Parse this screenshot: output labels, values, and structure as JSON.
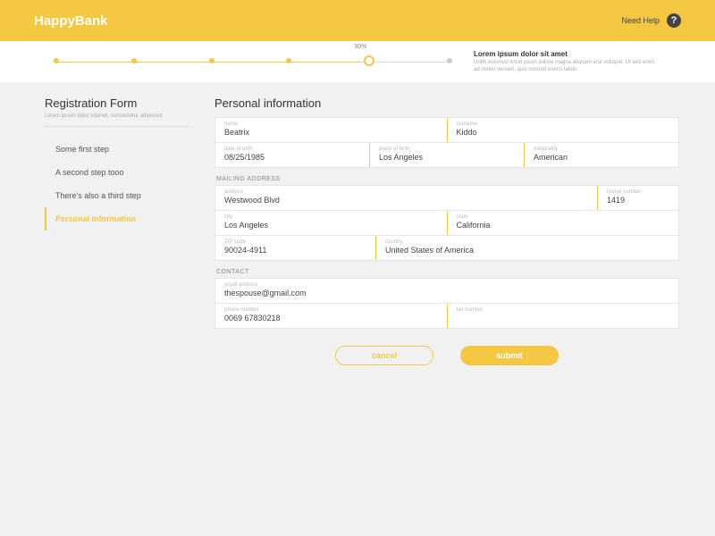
{
  "header": {
    "brand": "HappyBank",
    "help_label": "Need Help"
  },
  "progress": {
    "percent_label": "90%",
    "title": "Lorem ipsum dolor sit amet",
    "description": "Unbh euismod tincid psum dolore magna aliquam erat volutpat. Ut wisi enim ad minim veniam, quis nostrud exerci tation."
  },
  "sidebar": {
    "title": "Registration Form",
    "subtitle": "Lorem ipsum dolor sitamet, consectetur adipiscint",
    "steps": [
      "Some first step",
      "A second step tooo",
      "There's also a third step",
      "Personal information"
    ]
  },
  "content": {
    "title": "Personal information",
    "personal": {
      "name_label": "name",
      "name_value": "Beatrix",
      "surname_label": "surname",
      "surname_value": "Kiddo",
      "dob_label": "date of birth",
      "dob_value": "08/25/1985",
      "pob_label": "place of birth",
      "pob_value": "Los Angeles",
      "nat_label": "nationality",
      "nat_value": "American"
    },
    "mailing_section": "MAILING ADDRESS",
    "mailing": {
      "address_label": "address",
      "address_value": "Westwood Blvd",
      "house_label": "house number",
      "house_value": "1419",
      "city_label": "city",
      "city_value": "Los Angeles",
      "state_label": "state",
      "state_value": "California",
      "zip_label": "ZIP code",
      "zip_value": "90024-4911",
      "country_label": "country",
      "country_value": "United States of America"
    },
    "contact_section": "CONTACT",
    "contact": {
      "email_label": "email address",
      "email_value": "thespouse@gmail.com",
      "phone_label": "phone number",
      "phone_value": "0069 67830218",
      "fax_label": "fax number",
      "fax_value": ""
    },
    "buttons": {
      "cancel": "cancel",
      "submit": "submit"
    }
  },
  "colors": {
    "accent": "#f4c842"
  }
}
